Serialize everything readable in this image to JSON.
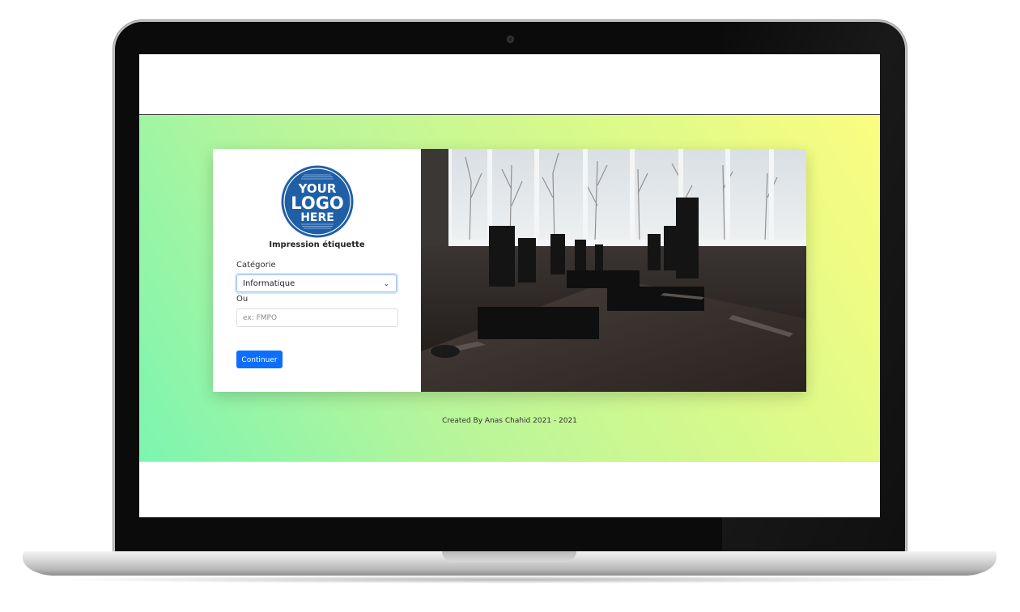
{
  "app": {
    "title": "Impression étiquette"
  },
  "logo": {
    "line1": "YOUR",
    "line2": "LOGO",
    "line3": "HERE"
  },
  "form": {
    "category_label": "Catégorie",
    "category_value": "Informatique",
    "or_label": "Ou",
    "search_placeholder": "ex: FMPO",
    "submit_label": "Continuer"
  },
  "footer": {
    "text": "Created By Anas Chahid 2021 - 2021"
  },
  "colors": {
    "primary": "#0d6efd",
    "logo_blue": "#1f5fa6",
    "gradient_left": "#7cf5b0",
    "gradient_right": "#fbfd7f"
  },
  "icons": {
    "select_arrow": "chevron-down-icon",
    "camera": "webcam-icon"
  }
}
